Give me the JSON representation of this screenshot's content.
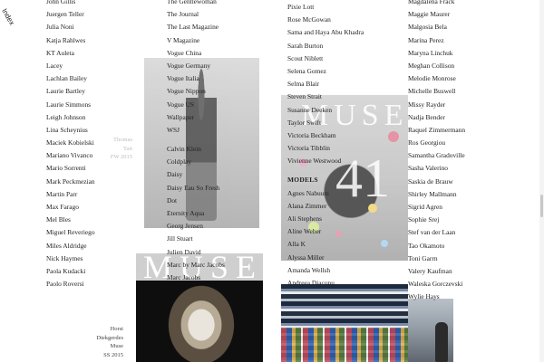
{
  "nav": {
    "index_label": "Index"
  },
  "columns": {
    "col1": [
      "John Gillis",
      "Juergen Teller",
      "Julia Noni",
      "Katja Rahlwes",
      "KT Auleta",
      "Lacey",
      "Lachlan Bailey",
      "Laurie Bartley",
      "Laurie Simmons",
      "Leigh Johnson",
      "Lina Scheynius",
      "Maciek Kobielski",
      "Mariano Vivanco",
      "Mario Sorrenti",
      "Mark Peckmezian",
      "Martin Parr",
      "Max Farago",
      "Mel Bles",
      "Miguel Reveriego",
      "Miles Aldridge",
      "Nick Haymes",
      "Paola Kudacki",
      "Paolo Roversi"
    ],
    "col2_a": [
      "The Gentlewoman",
      "The Journal",
      "The Last Magazine",
      "V Magazine",
      "Vogue China",
      "Vogue Germany",
      "Vogue Italia",
      "Vogue Nippon",
      "Vogue US",
      "Wallpaper",
      "WSJ"
    ],
    "col2_b": [
      "Calvin Klein",
      "Coldplay",
      "Daisy",
      "Daisy Eau So Fresh",
      "Dot",
      "Eternity Aqua",
      "Georg Jensen",
      "Jill Stuart",
      "Julien David",
      "Marc by Marc Jacobs",
      "Marc Jacobs"
    ],
    "col3_a": [
      "Pixie Lott",
      "Rose McGowan",
      "Sama and Haya Abu Khadra",
      "Sarah Burton",
      "Scout Niblett",
      "Selena Gomez",
      "Selma Blair",
      "Steven Strait",
      "Susanne Deeken",
      "Taylor Swift",
      "Victoria Beckham",
      "Victoria Tibblin",
      "Vivienne Westwood"
    ],
    "col3_models_heading": "MODELS",
    "col3_b": [
      "Agnes Nabuurs",
      "Alana Zimmer",
      "Ali Stephens",
      "Aline Weber",
      "Alla K",
      "Alyssa Miller",
      "Amanda Wellsh",
      "Andreea Diaconu"
    ],
    "col4": [
      "Magdalena Frack",
      "Maggie Maurer",
      "Malgosia Bela",
      "Marina Perez",
      "Maryna Linchuk",
      "Meghan Collison",
      "Melodie Monrose",
      "Michelle Buswell",
      "Missy Rayder",
      "Nadja Bender",
      "Raquel Zimmermann",
      "Ros Georgiou",
      "Samantha Gradoville",
      "Sasha Valerino",
      "Saskia de Brauw",
      "Shirley Mallmann",
      "Sigrid Agren",
      "Sophie Srej",
      "Stef van der Laan",
      "Tao Okamoto",
      "Toni Garrn",
      "Valery Kaufman",
      "Waleska Gorczevski",
      "Wylie Hays"
    ]
  },
  "captions": {
    "faint": [
      "Thomas",
      "Tait",
      "FW 2015"
    ],
    "bottom": [
      "Horst",
      "Diekgerdes",
      "Muse",
      "SS 2015"
    ]
  },
  "images": {
    "muse_word": "MUSE",
    "muse_number": "41"
  },
  "colors": {
    "text": "#222222",
    "caption_faint": "#bdbdbd",
    "background": "#ffffff"
  }
}
